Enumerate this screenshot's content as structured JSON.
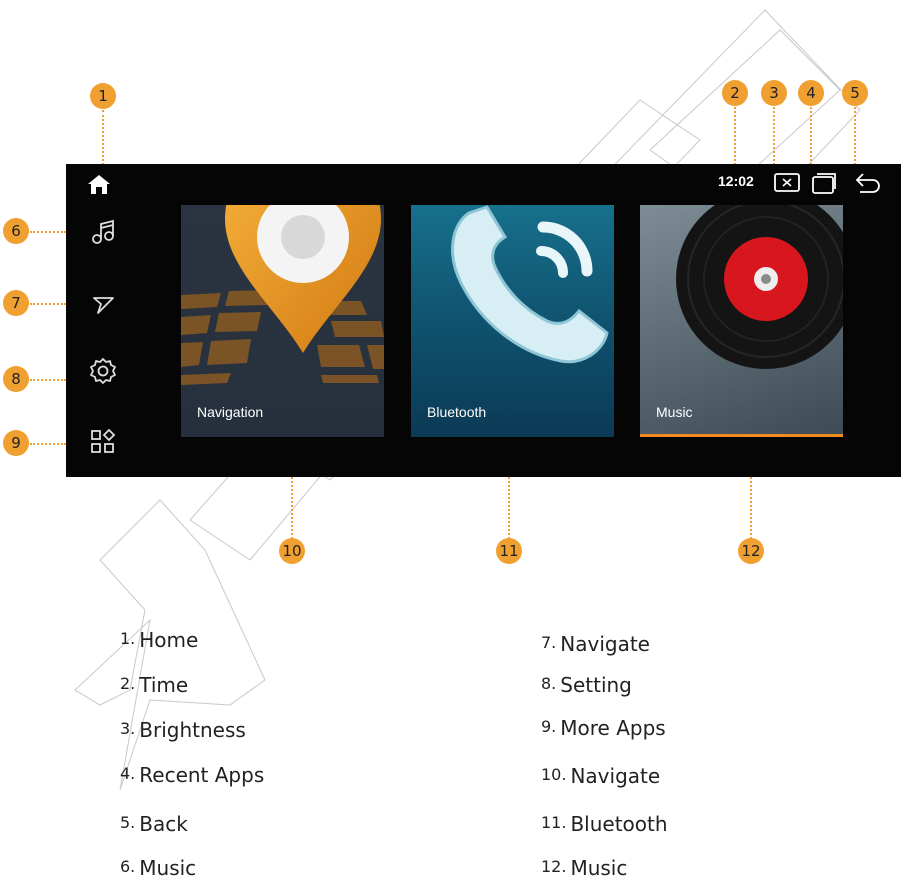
{
  "screen": {
    "time": "12:02",
    "cards": [
      {
        "label": "Navigation"
      },
      {
        "label": "Bluetooth"
      },
      {
        "label": "Music"
      }
    ]
  },
  "callouts": [
    "1",
    "2",
    "3",
    "4",
    "5",
    "6",
    "7",
    "8",
    "9",
    "10",
    "11",
    "12"
  ],
  "legend": [
    {
      "num": "1.",
      "text": "Home"
    },
    {
      "num": "2.",
      "text": "Time"
    },
    {
      "num": "3.",
      "text": "Brightness"
    },
    {
      "num": "4.",
      "text": "Recent Apps"
    },
    {
      "num": "5.",
      "text": "Back"
    },
    {
      "num": "6.",
      "text": "Music"
    },
    {
      "num": "7.",
      "text": "Navigate"
    },
    {
      "num": "8.",
      "text": "Setting"
    },
    {
      "num": "9.",
      "text": "More Apps"
    },
    {
      "num": "10.",
      "text": "Navigate"
    },
    {
      "num": "11.",
      "text": "Bluetooth"
    },
    {
      "num": "12.",
      "text": "Music"
    }
  ],
  "colors": {
    "accent": "#f0a030",
    "screen_bg": "#050505",
    "music_underline": "#f08c1e"
  }
}
